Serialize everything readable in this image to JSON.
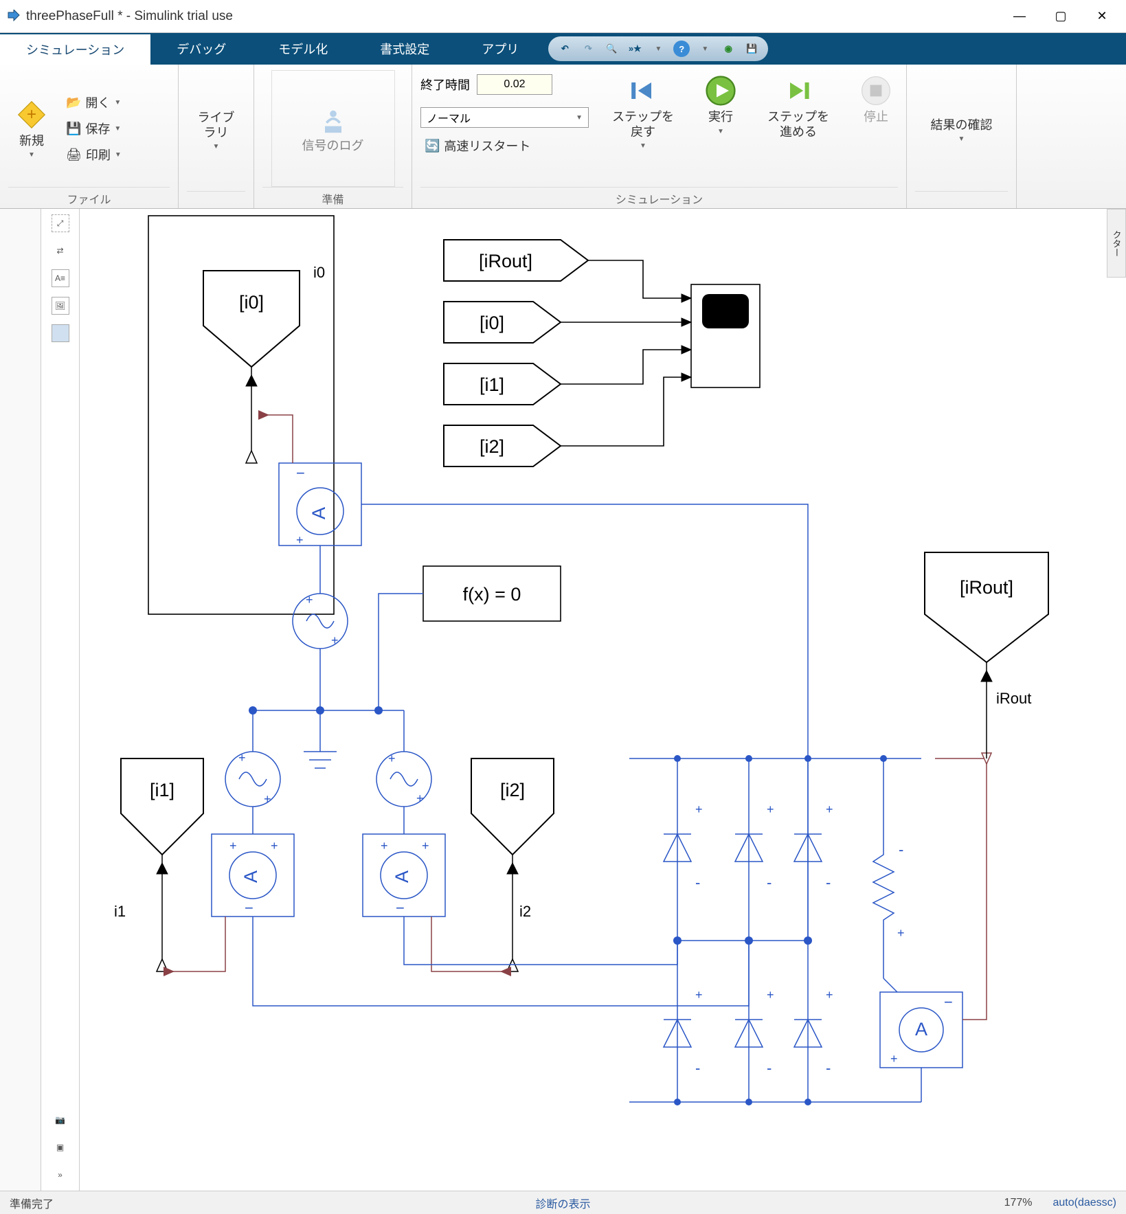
{
  "window": {
    "title": "threePhaseFull * - Simulink trial use"
  },
  "tabs": {
    "simulation": "シミュレーション",
    "debug": "デバッグ",
    "modeling": "モデル化",
    "format": "書式設定",
    "apps": "アプリ"
  },
  "ribbon": {
    "file_group": "ファイル",
    "new": "新規",
    "open": "開く",
    "save": "保存",
    "print": "印刷",
    "library": "ライブラリ",
    "prepare_group": "準備",
    "log_signals": "信号のログ",
    "stop_time_label": "終了時間",
    "stop_time_value": "0.02",
    "mode": "ノーマル",
    "fast_restart": "高速リスタート",
    "simulate_group": "シミュレーション",
    "step_back": "ステップを\n戻す",
    "run": "実行",
    "step_fwd": "ステップを\n進める",
    "stop": "停止",
    "review": "結果の確認"
  },
  "side_tab": "クター",
  "diagram": {
    "goto_i0": "[i0]",
    "goto_i1": "[i1]",
    "goto_i2": "[i2]",
    "from_iRout": "[iRout]",
    "from_i0": "[i0]",
    "from_i1": "[i1]",
    "from_i2": "[i2]",
    "goto_iRout": "[iRout]",
    "sig_i0": "i0",
    "sig_i1": "i1",
    "sig_i2": "i2",
    "sig_iRout": "iRout",
    "solver": "f(x) = 0",
    "amp_letter": "A"
  },
  "status": {
    "ready": "準備完了",
    "diagnostics": "診断の表示",
    "zoom": "177%",
    "solver": "auto(daessc)"
  }
}
